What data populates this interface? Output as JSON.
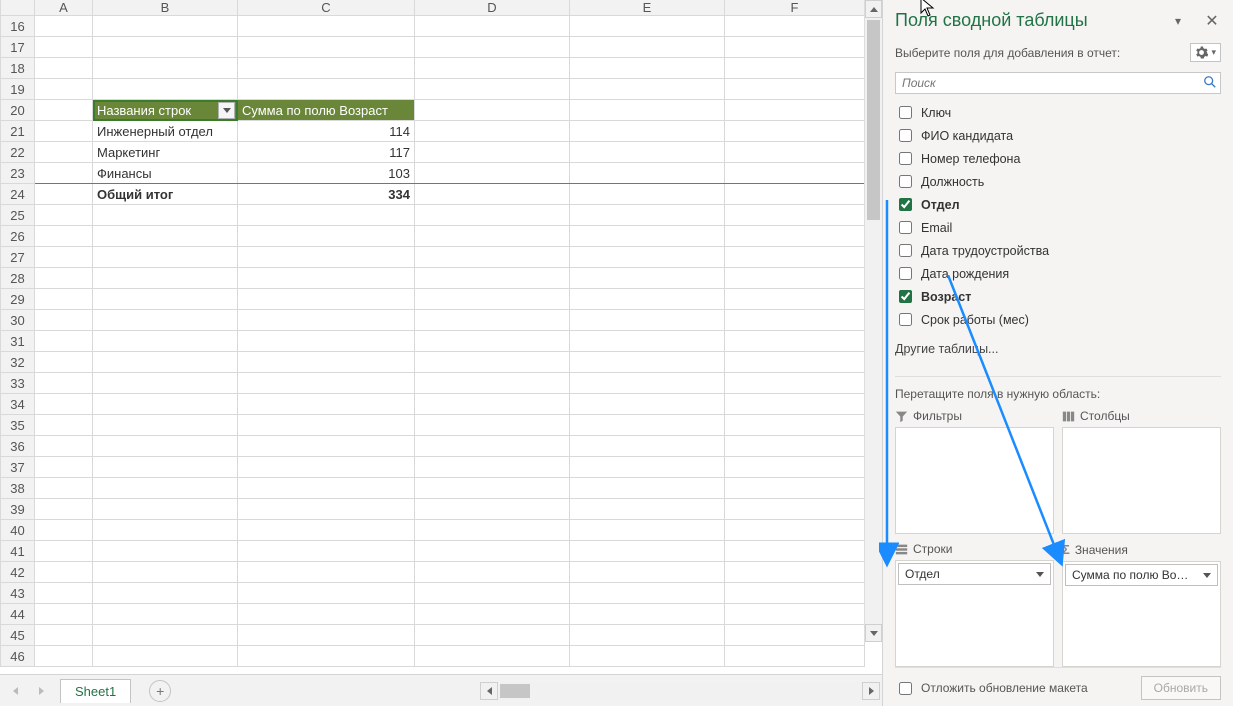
{
  "spreadsheet": {
    "columns": [
      "A",
      "B",
      "C",
      "D",
      "E",
      "F"
    ],
    "row_start": 16,
    "row_end": 46,
    "pivot": {
      "header_row_labels": "Названия строк",
      "header_sum": "Сумма по полю Возраст",
      "rows": [
        {
          "label": "Инженерный отдел",
          "value": "114"
        },
        {
          "label": "Маркетинг",
          "value": "117"
        },
        {
          "label": "Финансы",
          "value": "103"
        }
      ],
      "total_label": "Общий итог",
      "total_value": "334"
    },
    "sheet_tab": "Sheet1"
  },
  "panel": {
    "title": "Поля сводной таблицы",
    "subtitle": "Выберите поля для добавления в отчет:",
    "search_placeholder": "Поиск",
    "fields": [
      {
        "name": "Ключ",
        "checked": false
      },
      {
        "name": "ФИО кандидата",
        "checked": false
      },
      {
        "name": "Номер телефона",
        "checked": false
      },
      {
        "name": "Должность",
        "checked": false
      },
      {
        "name": "Отдел",
        "checked": true
      },
      {
        "name": "Email",
        "checked": false
      },
      {
        "name": "Дата трудоустройства",
        "checked": false
      },
      {
        "name": "Дата рождения",
        "checked": false
      },
      {
        "name": "Возраст",
        "checked": true
      },
      {
        "name": "Срок работы (мес)",
        "checked": false
      }
    ],
    "other_tables": "Другие таблицы...",
    "drag_instruction": "Перетащите поля в нужную область:",
    "areas": {
      "filters_label": "Фильтры",
      "columns_label": "Столбцы",
      "rows_label": "Строки",
      "values_label": "Значения",
      "rows_item": "Отдел",
      "values_item": "Сумма по полю Возраст"
    },
    "defer_label": "Отложить обновление макета",
    "update_button": "Обновить"
  }
}
